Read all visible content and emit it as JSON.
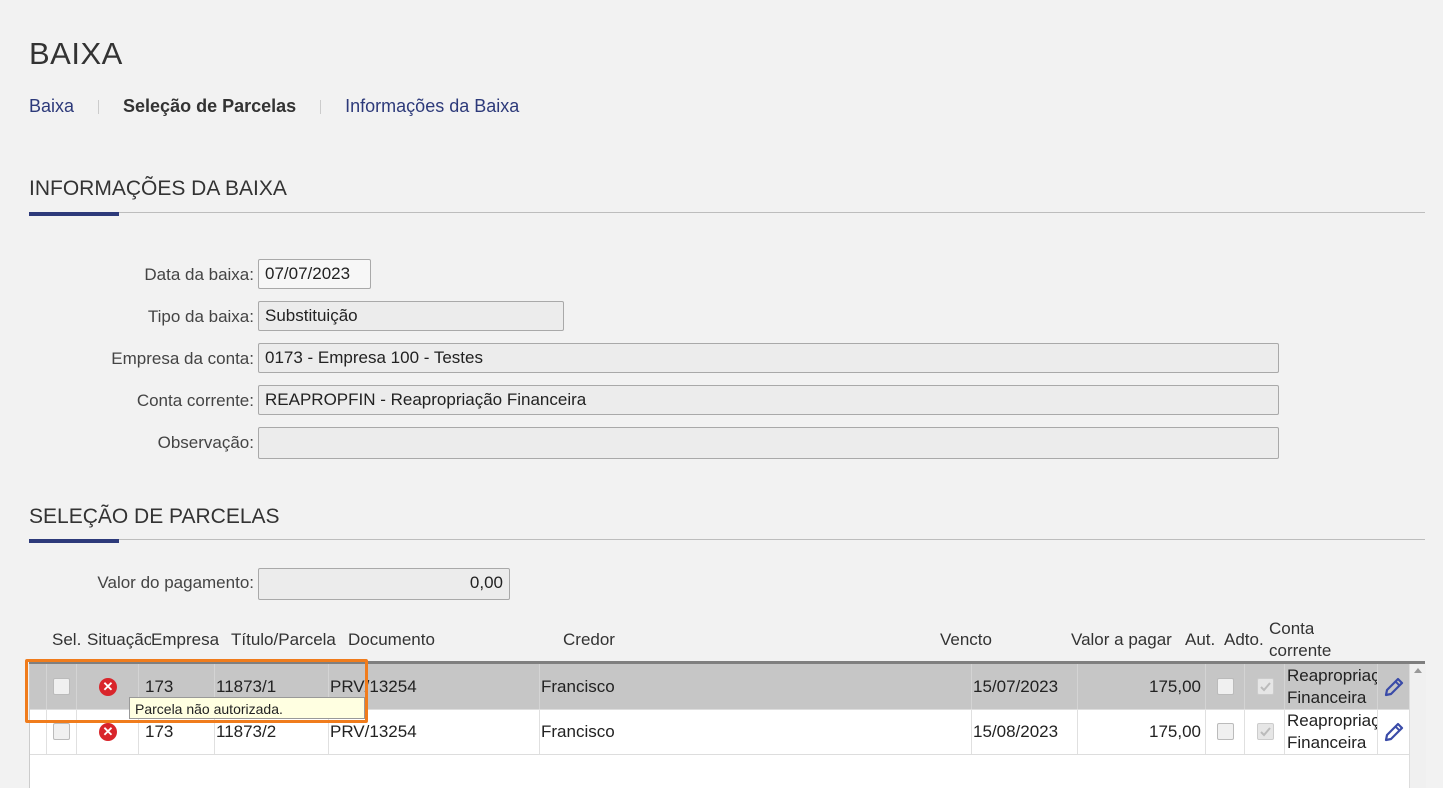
{
  "page": {
    "title": "BAIXA"
  },
  "tabs": [
    {
      "label": "Baixa"
    },
    {
      "label": "Seleção de Parcelas"
    },
    {
      "label": "Informações da Baixa"
    }
  ],
  "info_section": {
    "title": "INFORMAÇÕES DA BAIXA",
    "fields": {
      "data_label": "Data da baixa:",
      "data_value": "07/07/2023",
      "tipo_label": "Tipo da baixa:",
      "tipo_value": "Substituição",
      "empresa_label": "Empresa da conta:",
      "empresa_value": "0173 - Empresa 100 - Testes",
      "conta_label": "Conta corrente:",
      "conta_value": "REAPROPFIN - Reapropriação Financeira",
      "obs_label": "Observação:",
      "obs_value": ""
    }
  },
  "parcelas_section": {
    "title": "SELEÇÃO DE PARCELAS",
    "valor_label": "Valor do pagamento:",
    "valor_value": "0,00"
  },
  "grid": {
    "headers": {
      "sel": "Sel.",
      "situacao": "Situação",
      "empresa": "Empresa",
      "titulo": "Título/Parcela",
      "documento": "Documento",
      "credor": "Credor",
      "vencto": "Vencto",
      "valor": "Valor a pagar",
      "aut": "Aut.",
      "adto": "Adto.",
      "conta_l1": "Conta",
      "conta_l2": "corrente"
    },
    "rows": [
      {
        "empresa": "173",
        "titulo": "11873/1",
        "documento": "PRV/13254",
        "credor": "Francisco",
        "vencto": "15/07/2023",
        "valor": "175,00",
        "conta_l1": "Reapropriação",
        "conta_l2": "Financeira",
        "selected": true
      },
      {
        "empresa": "173",
        "titulo": "11873/2",
        "documento": "PRV/13254",
        "credor": "Francisco",
        "vencto": "15/08/2023",
        "valor": "175,00",
        "conta_l1": "Reapropriação",
        "conta_l2": "Financeira",
        "selected": false
      }
    ],
    "tooltip": "Parcela não autorizada."
  },
  "colors": {
    "accent": "#2d3a7a",
    "error": "#d9252b",
    "highlight": "#f07c1c",
    "tooltip_bg": "#ffffe1"
  },
  "icons": [
    "error-circle-icon",
    "edit-pencil-icon",
    "scroll-up-icon"
  ]
}
